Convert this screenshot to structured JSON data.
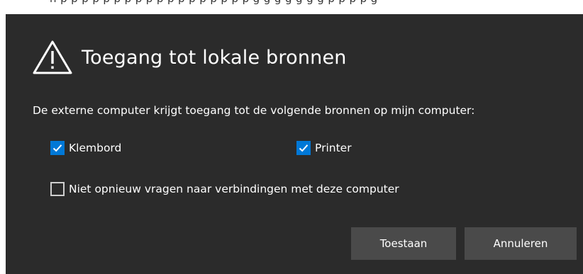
{
  "background": {
    "partial_text": "...n: [placeholder text visible above the dialog, partially cut off]..."
  },
  "dialog": {
    "title": "Toegang tot lokale bronnen",
    "description": "De externe computer krijgt toegang tot de volgende bronnen op mijn computer:",
    "resources": [
      {
        "label": "Klembord",
        "checked": true
      },
      {
        "label": "Printer",
        "checked": true
      }
    ],
    "dont_ask_again": {
      "label": "Niet opnieuw vragen naar verbindingen met deze computer",
      "checked": false
    },
    "buttons": {
      "allow": "Toestaan",
      "cancel": "Annuleren"
    }
  },
  "colors": {
    "dialog_bg": "#2b2b2b",
    "button_bg": "#4a4a4a",
    "accent": "#0078d7",
    "text": "#ffffff"
  },
  "icons": {
    "title": "warning-icon",
    "check": "checkmark-icon"
  }
}
